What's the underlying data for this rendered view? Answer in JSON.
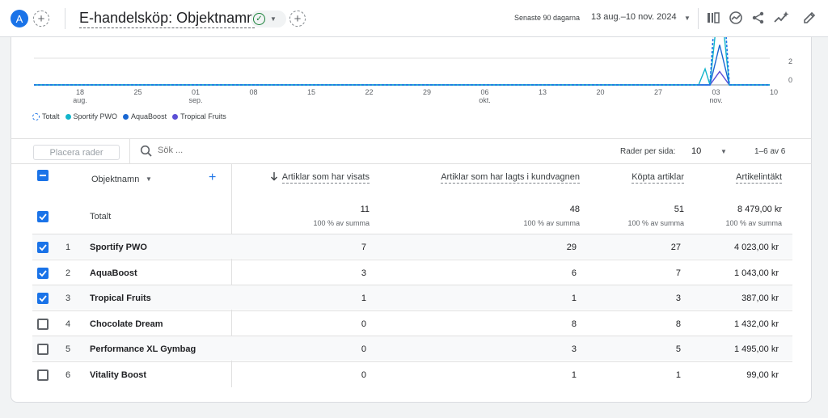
{
  "header": {
    "avatar_letter": "A",
    "title": "E-handelsköp: Objektnamn",
    "date_label": "Senaste 90 dagarna",
    "date_range": "13 aug.–10 nov. 2024"
  },
  "chart_data": {
    "type": "line",
    "y_tick_labels": [
      "2",
      "0"
    ],
    "x_tick_labels": [
      {
        "day": "18",
        "month": "aug."
      },
      {
        "day": "25",
        "month": ""
      },
      {
        "day": "01",
        "month": "sep."
      },
      {
        "day": "08",
        "month": ""
      },
      {
        "day": "15",
        "month": ""
      },
      {
        "day": "22",
        "month": ""
      },
      {
        "day": "29",
        "month": ""
      },
      {
        "day": "06",
        "month": "okt."
      },
      {
        "day": "13",
        "month": ""
      },
      {
        "day": "20",
        "month": ""
      },
      {
        "day": "27",
        "month": ""
      },
      {
        "day": "03",
        "month": "nov."
      },
      {
        "day": "10",
        "month": ""
      }
    ],
    "series": [
      {
        "name": "Totalt",
        "color": "#1a73e8",
        "style": "dashed",
        "peak": 11
      },
      {
        "name": "Sportify PWO",
        "color": "#12b5cb",
        "peak": 7
      },
      {
        "name": "AquaBoost",
        "color": "#1967d2",
        "peak": 3
      },
      {
        "name": "Tropical Fruits",
        "color": "#5b4fd6",
        "peak": 1
      }
    ]
  },
  "table_toolbar": {
    "place_rows_placeholder": "Placera rader",
    "search_placeholder": "Sök ...",
    "rows_per_page_label": "Rader per sida:",
    "rows_per_page_value": "10",
    "paging": "1–6 av 6"
  },
  "table": {
    "columns": {
      "dimension": "Objektnamn",
      "viewed": "Artiklar som har visats",
      "added": "Artiklar som har lagts i kundvagnen",
      "purchased": "Köpta artiklar",
      "revenue": "Artikelintäkt"
    },
    "totals": {
      "label": "Totalt",
      "viewed": "11",
      "added": "48",
      "purchased": "51",
      "revenue": "8 479,00 kr",
      "pct": "100 % av summa"
    },
    "rows": [
      {
        "rank": "1",
        "name": "Sportify PWO",
        "viewed": "7",
        "added": "29",
        "purchased": "27",
        "revenue": "4 023,00 kr",
        "checked": true
      },
      {
        "rank": "2",
        "name": "AquaBoost",
        "viewed": "3",
        "added": "6",
        "purchased": "7",
        "revenue": "1 043,00 kr",
        "checked": true
      },
      {
        "rank": "3",
        "name": "Tropical Fruits",
        "viewed": "1",
        "added": "1",
        "purchased": "3",
        "revenue": "387,00 kr",
        "checked": true
      },
      {
        "rank": "4",
        "name": "Chocolate Dream",
        "viewed": "0",
        "added": "8",
        "purchased": "8",
        "revenue": "1 432,00 kr",
        "checked": false
      },
      {
        "rank": "5",
        "name": "Performance XL Gymbag",
        "viewed": "0",
        "added": "3",
        "purchased": "5",
        "revenue": "1 495,00 kr",
        "checked": false
      },
      {
        "rank": "6",
        "name": "Vitality Boost",
        "viewed": "0",
        "added": "1",
        "purchased": "1",
        "revenue": "99,00 kr",
        "checked": false
      }
    ]
  }
}
